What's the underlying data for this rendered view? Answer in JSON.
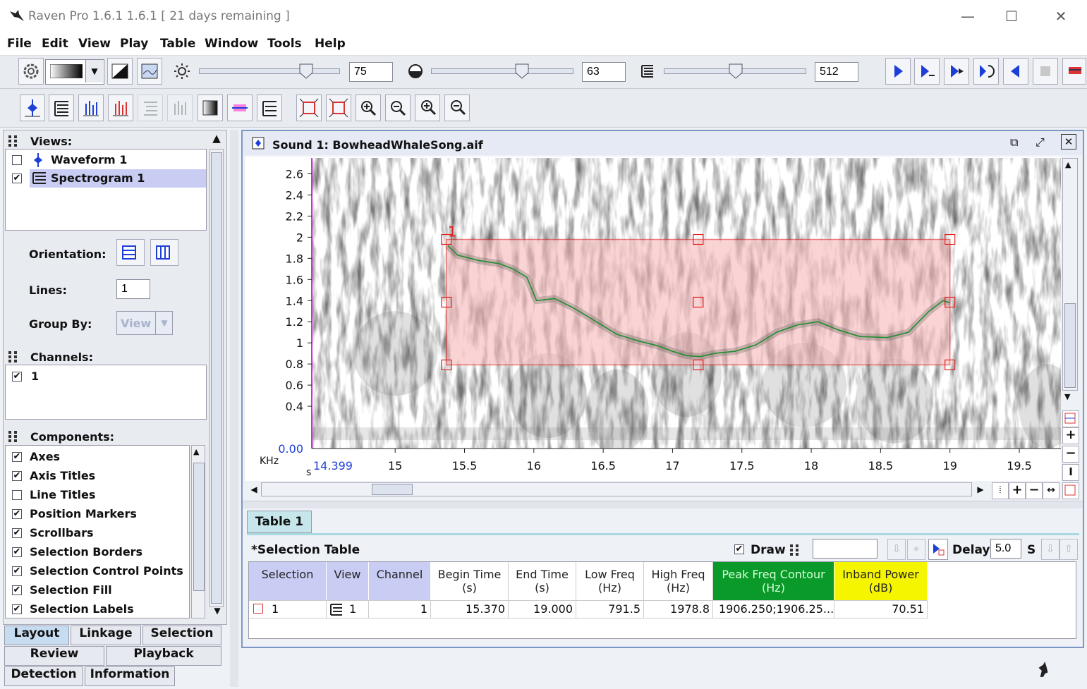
{
  "window": {
    "title": "Raven Pro 1.6.1 1.6.1  [ 21 days remaining ]"
  },
  "menu": [
    "File",
    "Edit",
    "View",
    "Play",
    "Table",
    "Window",
    "Tools",
    "Help"
  ],
  "toolbar": {
    "brightness": "75",
    "contrast": "63",
    "size": "512"
  },
  "views": {
    "header": "Views:",
    "items": [
      {
        "label": "Waveform 1",
        "checked": false
      },
      {
        "label": "Spectrogram 1",
        "checked": true
      }
    ]
  },
  "layout": {
    "orientation_label": "Orientation:",
    "lines_label": "Lines:",
    "lines_value": "1",
    "groupby_label": "Group By:",
    "groupby_value": "View"
  },
  "channels": {
    "header": "Channels:",
    "items": [
      {
        "label": "1",
        "checked": true
      }
    ]
  },
  "components": {
    "header": "Components:",
    "items": [
      {
        "label": "Axes",
        "checked": true
      },
      {
        "label": "Axis Titles",
        "checked": true
      },
      {
        "label": "Line Titles",
        "checked": false
      },
      {
        "label": "Position Markers",
        "checked": true
      },
      {
        "label": "Scrollbars",
        "checked": true
      },
      {
        "label": "Selection Borders",
        "checked": true
      },
      {
        "label": "Selection Control Points",
        "checked": true
      },
      {
        "label": "Selection Fill",
        "checked": true
      },
      {
        "label": "Selection Labels",
        "checked": true
      }
    ]
  },
  "bottom_tabs": [
    "Layout",
    "Linkage",
    "Selection",
    "Review",
    "Playback",
    "Detection",
    "Information"
  ],
  "sound": {
    "title": "Sound 1: BowheadWhaleSong.aif"
  },
  "spectrogram": {
    "y_ticks": [
      "2.6",
      "2.4",
      "2.2",
      "2",
      "1.8",
      "1.6",
      "1.4",
      "1.2",
      "1",
      "0.8",
      "0.6",
      "0.4"
    ],
    "y_start": "0.00",
    "y_unit": "KHz",
    "x_start": "14.399",
    "x_unit": "s",
    "x_ticks": [
      "15",
      "15.5",
      "16",
      "16.5",
      "17",
      "17.5",
      "18",
      "18.5",
      "19",
      "19.5"
    ],
    "selection_label": "1",
    "selection": {
      "begin_s": 15.37,
      "end_s": 19.0,
      "low_khz": 0.7915,
      "high_khz": 1.9788
    }
  },
  "table_tab": "Table 1",
  "selection_table": {
    "title": "*Selection Table",
    "draw_label": "Draw",
    "delay_label": "Delay:",
    "delay_value": "5.0",
    "delay_unit": "S",
    "columns": [
      {
        "l1": "Selection",
        "l2": ""
      },
      {
        "l1": "View",
        "l2": ""
      },
      {
        "l1": "Channel",
        "l2": ""
      },
      {
        "l1": "Begin Time",
        "l2": "(s)"
      },
      {
        "l1": "End Time",
        "l2": "(s)"
      },
      {
        "l1": "Low Freq",
        "l2": "(Hz)"
      },
      {
        "l1": "High Freq",
        "l2": "(Hz)"
      },
      {
        "l1": "Peak Freq Contour",
        "l2": "(Hz)"
      },
      {
        "l1": "Inband Power",
        "l2": "(dB)"
      }
    ],
    "row": {
      "selection": "1",
      "view": "1",
      "channel": "1",
      "begin": "15.370",
      "end": "19.000",
      "low": "791.5",
      "high": "1978.8",
      "contour": "1906.250;1906.25...",
      "power": "70.51"
    }
  },
  "colors": {
    "selection_border": "#e02020",
    "contour": "#1f8f2f",
    "peak_col": "#0a9a2a",
    "power_col": "#f5f500",
    "header_col": "#c9cdf4"
  }
}
